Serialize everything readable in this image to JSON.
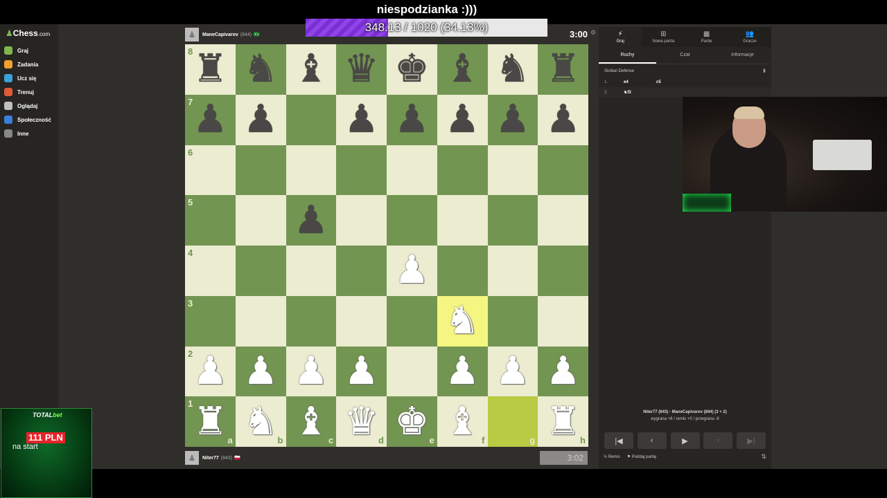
{
  "stream": {
    "title": "niespodzianka :)))",
    "goal_text": "348.13 / 1020 (34.13%)",
    "goal_fraction": 0.3413
  },
  "sidebar": {
    "logo_text": "Chess",
    "logo_domain": ".com",
    "items": [
      {
        "label": "Graj",
        "icon": "play-icon",
        "color": "#81b64c"
      },
      {
        "label": "Zadania",
        "icon": "puzzle-icon",
        "color": "#f0a030"
      },
      {
        "label": "Ucz się",
        "icon": "learn-icon",
        "color": "#3aa3d9"
      },
      {
        "label": "Trenuj",
        "icon": "train-icon",
        "color": "#e05a3a"
      },
      {
        "label": "Oglądaj",
        "icon": "watch-icon",
        "color": "#c0c0c0"
      },
      {
        "label": "Społeczność",
        "icon": "community-icon",
        "color": "#3a7fd9"
      },
      {
        "label": "Inne",
        "icon": "more-icon",
        "color": "#888888"
      }
    ]
  },
  "top_player": {
    "name": "ManeCapivarov",
    "rating": "(844)",
    "flag": "🇧🇷",
    "clock": "3:00"
  },
  "bottom_player": {
    "name": "Niter77",
    "rating": "(843)",
    "flag": "🇵🇱",
    "clock": "3:02"
  },
  "board": {
    "light_color": "#ebecd0",
    "dark_color": "#739552",
    "highlight_squares": [
      "f3",
      "g1"
    ],
    "ranks": [
      "8",
      "7",
      "6",
      "5",
      "4",
      "3",
      "2",
      "1"
    ],
    "files": [
      "a",
      "b",
      "c",
      "d",
      "e",
      "f",
      "g",
      "h"
    ],
    "rows": [
      [
        "bR",
        "bN",
        "bB",
        "bQ",
        "bK",
        "bB",
        "bN",
        "bR"
      ],
      [
        "bP",
        "bP",
        "",
        "bP",
        "bP",
        "bP",
        "bP",
        "bP"
      ],
      [
        "",
        "",
        "",
        "",
        "",
        "",
        "",
        ""
      ],
      [
        "",
        "",
        "bP",
        "",
        "",
        "",
        "",
        ""
      ],
      [
        "",
        "",
        "",
        "",
        "wP",
        "",
        "",
        ""
      ],
      [
        "",
        "",
        "",
        "",
        "",
        "wN",
        "",
        ""
      ],
      [
        "wP",
        "wP",
        "wP",
        "wP",
        "",
        "wP",
        "wP",
        "wP"
      ],
      [
        "wR",
        "wN",
        "wB",
        "wQ",
        "wK",
        "wB",
        "",
        "wR"
      ]
    ]
  },
  "panel": {
    "tabs": [
      {
        "label": "Graj",
        "icon": "bolt-icon",
        "active": true
      },
      {
        "label": "Nowa partia",
        "icon": "plus-icon",
        "active": false
      },
      {
        "label": "Partie",
        "icon": "board-icon",
        "active": false
      },
      {
        "label": "Gracze",
        "icon": "players-icon",
        "active": false
      }
    ],
    "subtabs": [
      {
        "label": "Ruchy",
        "active": true
      },
      {
        "label": "Czat",
        "active": false
      },
      {
        "label": "Informacje",
        "active": false
      }
    ],
    "opening": "Sicilian Defense",
    "moves": [
      {
        "num": "1.",
        "white": "e4",
        "black": "c5"
      },
      {
        "num": "2.",
        "white": "♞f3",
        "black": ""
      }
    ],
    "result_line1": "Niter77 (843) - ManeCapivarov (844) (3 + 2)",
    "result_line2": "wygrana +8 / remis +0 / przegrana -8",
    "draw_label": "Remis",
    "draw_symbol": "½",
    "resign_label": "Poddaj partię"
  },
  "ad": {
    "brand_a": "TOTAL",
    "brand_b": "bet",
    "amount": "111 PLN",
    "sub": "na start"
  }
}
